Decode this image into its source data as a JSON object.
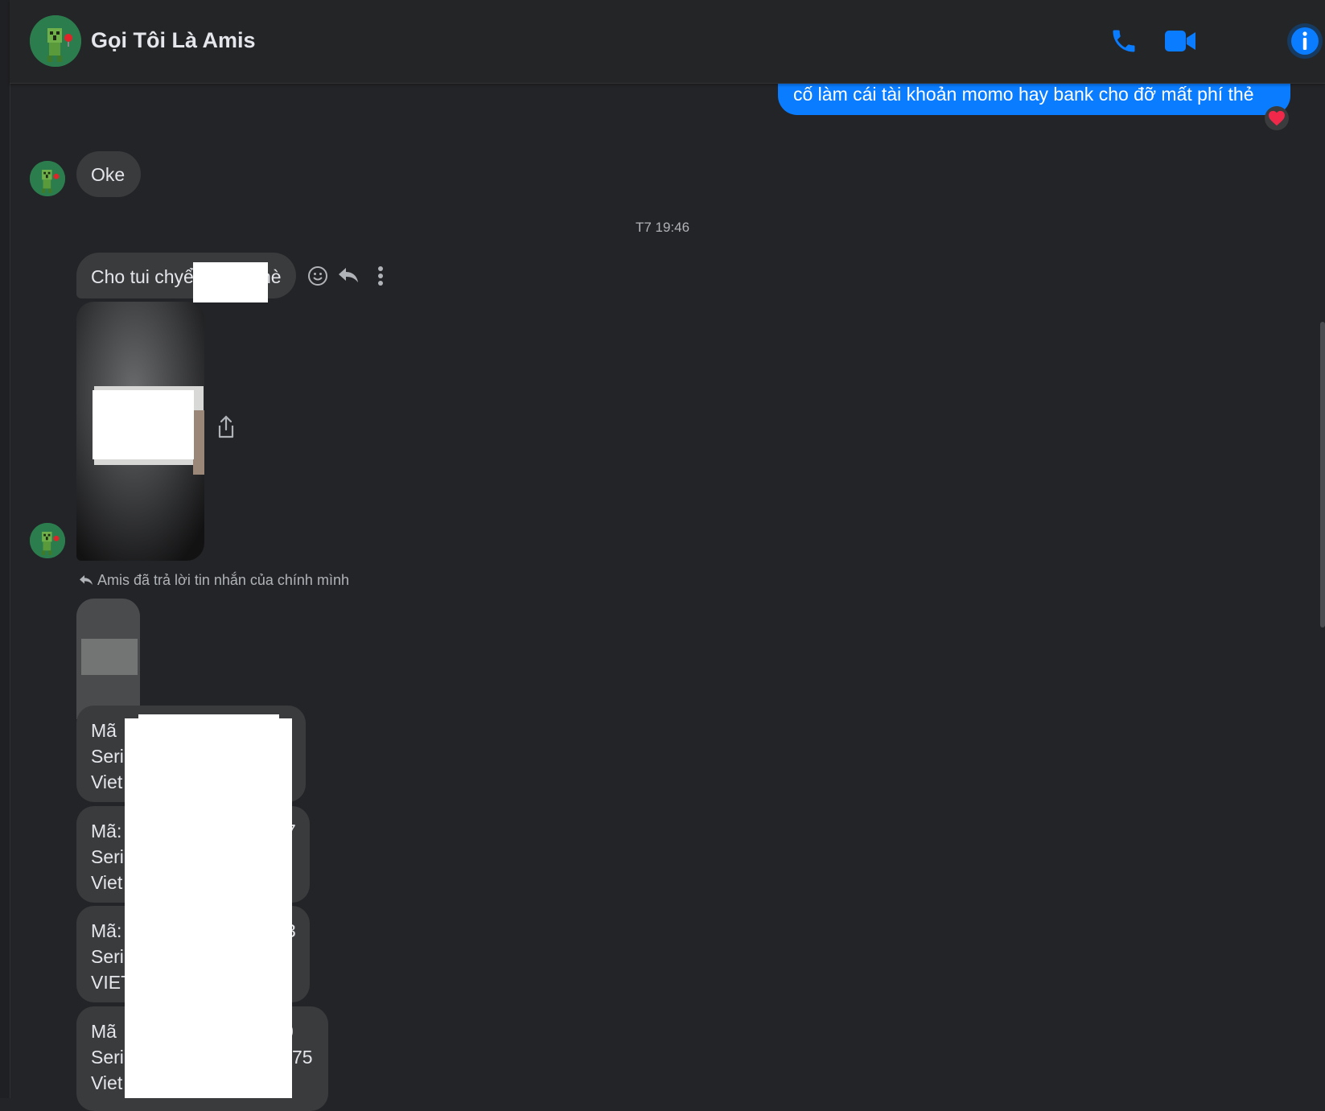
{
  "header": {
    "title": "Gọi Tôi Là Amis",
    "icons": [
      "phone-icon",
      "video-call-icon",
      "info-icon"
    ],
    "accent_color": "#0a7cff"
  },
  "messages": {
    "outgoing_1": "cố làm cái tài khoản momo hay bank cho đỡ mất phí thẻ",
    "reaction": "❤️",
    "incoming_oke": "Oke",
    "timestamp": "T7 19:46",
    "incoming_cho_tui": "Cho tui chyể",
    "incoming_cho_tui_tail": "hè",
    "reply_note": "Amis đã trả lời tin nhắn của chính mình"
  },
  "cards": [
    {
      "l1": "Mã",
      "l1_tail": "",
      "l2": "Seri",
      "l2_tail": "",
      "l3": "Viet",
      "l3_tail": ""
    },
    {
      "l1": "Mã:",
      "l1_tail": "7",
      "l2": "Seri",
      "l2_tail": "",
      "l3": "Viet",
      "l3_tail": ""
    },
    {
      "l1": "Mã:",
      "l1_tail": "3",
      "l2": "Seri",
      "l2_tail": "",
      "l3": "VIET",
      "l3_tail": ""
    },
    {
      "l1": "Mã",
      "l1_tail": "0",
      "l2": "Seri",
      "l2_tail": "75",
      "l3": "Viet",
      "l3_tail": ""
    }
  ],
  "colors": {
    "background": "#232427",
    "incoming_bubble": "#3a3b3c",
    "outgoing_bubble": "#0a7cff",
    "muted_text": "#b0b3b8"
  }
}
